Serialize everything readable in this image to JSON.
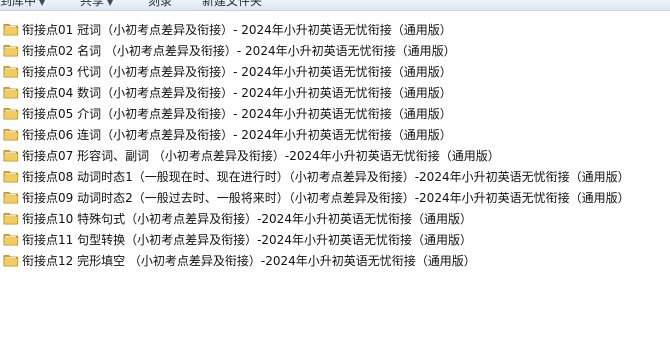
{
  "toolbar": {
    "items": [
      {
        "label": "到库中",
        "has_arrow": true
      },
      {
        "label": "共享",
        "has_arrow": true
      },
      {
        "label": "刻录",
        "has_arrow": false
      },
      {
        "label": "新建文件夹",
        "has_arrow": false
      }
    ]
  },
  "files": [
    {
      "name": "衔接点01  冠词（小初考点差异及衔接）- 2024年小升初英语无忧衔接（通用版）",
      "icon": "folder-icon"
    },
    {
      "name": "衔接点02  名词 （小初考点差异及衔接）- 2024年小升初英语无忧衔接（通用版）",
      "icon": "folder-icon"
    },
    {
      "name": "衔接点03  代词（小初考点差异及衔接）- 2024年小升初英语无忧衔接（通用版）",
      "icon": "folder-icon"
    },
    {
      "name": "衔接点04  数词（小初考点差异及衔接）- 2024年小升初英语无忧衔接（通用版）",
      "icon": "folder-icon"
    },
    {
      "name": "衔接点05  介词（小初考点差异及衔接）- 2024年小升初英语无忧衔接（通用版）",
      "icon": "folder-icon"
    },
    {
      "name": "衔接点06  连词（小初考点差异及衔接）- 2024年小升初英语无忧衔接（通用版）",
      "icon": "folder-icon"
    },
    {
      "name": "衔接点07  形容词、副词 （小初考点差异及衔接）-2024年小升初英语无忧衔接（通用版）",
      "icon": "folder-icon"
    },
    {
      "name": "衔接点08  动词时态1（一般现在时、现在进行时）（小初考点差异及衔接）-2024年小升初英语无忧衔接（通用版）",
      "icon": "folder-icon"
    },
    {
      "name": "衔接点09  动词时态2（一般过去时、一般将来时）（小初考点差异及衔接）-2024年小升初英语无忧衔接（通用版）",
      "icon": "folder-icon"
    },
    {
      "name": "衔接点10  特殊句式（小初考点差异及衔接）-2024年小升初英语无忧衔接（通用版）",
      "icon": "folder-icon"
    },
    {
      "name": "衔接点11  句型转换（小初考点差异及衔接）-2024年小升初英语无忧衔接（通用版）",
      "icon": "folder-icon"
    },
    {
      "name": "衔接点12  完形填空  （小初考点差异及衔接）-2024年小升初英语无忧衔接（通用版）",
      "icon": "folder-icon"
    }
  ],
  "colors": {
    "folder_back": "#d9a424",
    "folder_front": "#f3cd5c",
    "folder_edge": "#b8861a"
  }
}
